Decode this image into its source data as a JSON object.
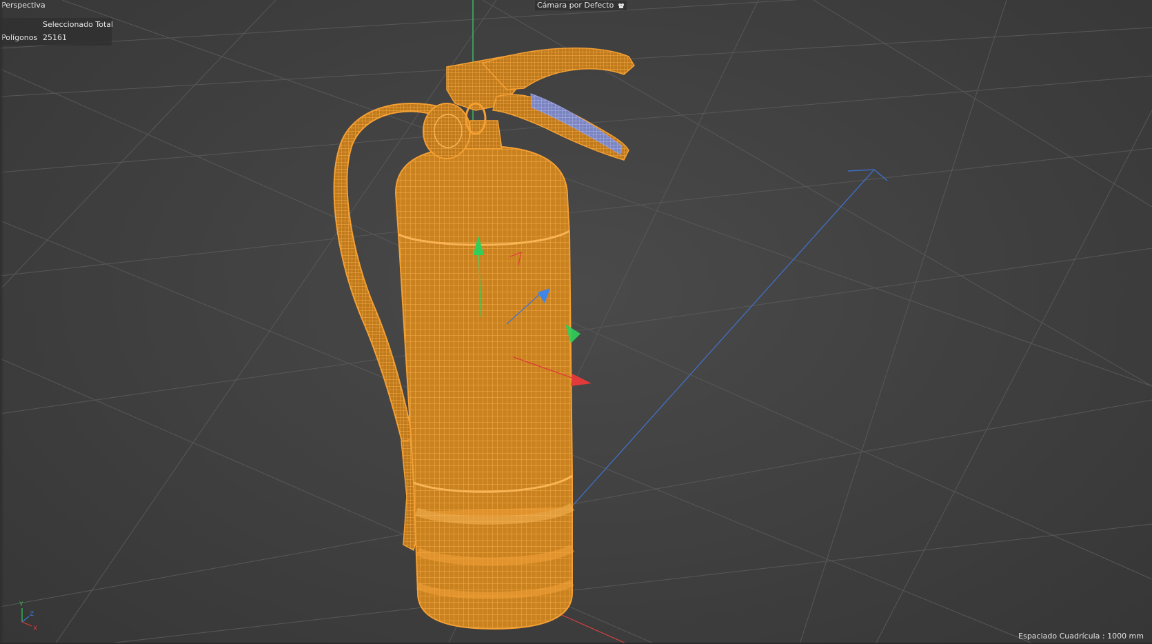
{
  "viewport": {
    "view_name": "Perspectiva",
    "camera_label": "Cámara por Defecto",
    "camera_icon": "camera-icon"
  },
  "info_panel": {
    "header": "Seleccionado Total",
    "rows": [
      {
        "label": "Polígonos",
        "value": "25161"
      }
    ]
  },
  "status": {
    "grid_spacing": "Espaciado Cuadrícula : 1000 mm"
  },
  "axis_triad": {
    "x_label": "X",
    "y_label": "Y",
    "z_label": "Z"
  },
  "colors": {
    "background": "#414141",
    "grid_line": "#5a5a5a",
    "selection_wire": "#f5a033",
    "axis_x": "#e03a3a",
    "axis_y": "#2fcf5a",
    "axis_z": "#3f78e0"
  },
  "scene": {
    "selected_object": "extintor"
  }
}
